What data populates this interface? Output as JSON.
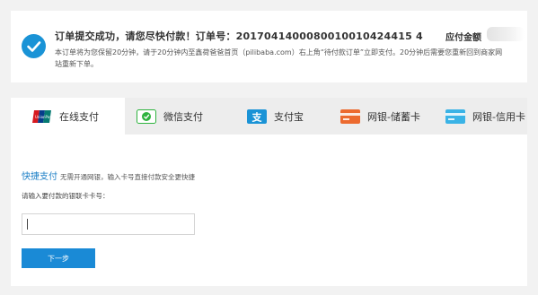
{
  "order": {
    "title": "订单提交成功，请您尽快付款！订单号：2017041400080010010424415 4",
    "amount_label": "应付金额",
    "description": "本订单将为您保留20分钟，请于20分钟内至鑫荷爸爸首页（pilibaba.com）右上角“待付款订单”立即支付。20分钟后需要您重新回到商家网站重新下单。"
  },
  "tabs": [
    {
      "label": "在线支付",
      "icon": "unionpay-icon",
      "active": true
    },
    {
      "label": "微信支付",
      "icon": "wechat-pay-icon",
      "active": false
    },
    {
      "label": "支付宝",
      "icon": "alipay-icon",
      "active": false
    },
    {
      "label": "网银-储蓄卡",
      "icon": "debit-card-icon",
      "active": false
    },
    {
      "label": "网银-信用卡",
      "icon": "credit-card-icon",
      "active": false
    }
  ],
  "quick_pay": {
    "title": "快捷支付",
    "description": "无需开通网银，输入卡号直接付款安全更快捷"
  },
  "card_input": {
    "label": "请输入要付款的银联卡卡号：",
    "value": ""
  },
  "next_label": "下一步",
  "colors": {
    "accent": "#1a8ad6",
    "check": "#1a93d6",
    "wechat": "#2fb33f",
    "debit": "#ec6a2f",
    "credit": "#3ab3e6"
  }
}
